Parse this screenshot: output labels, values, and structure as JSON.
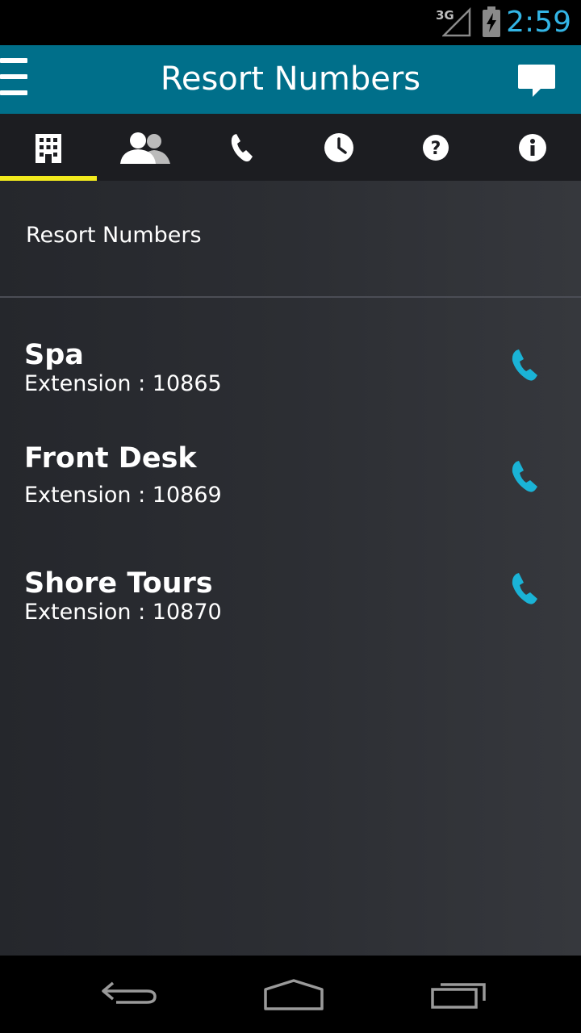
{
  "status_bar": {
    "network": "3G",
    "time": "2:59",
    "icons": [
      "signal-icon",
      "battery-charging-icon"
    ]
  },
  "action_bar": {
    "title": "Resort Numbers",
    "left_icon": "menu-icon",
    "right_icon": "chat-bubble-icon"
  },
  "tabs": [
    {
      "icon": "building-icon",
      "active": true
    },
    {
      "icon": "people-icon",
      "active": false
    },
    {
      "icon": "phone-icon",
      "active": false
    },
    {
      "icon": "clock-icon",
      "active": false
    },
    {
      "icon": "help-icon",
      "active": false
    },
    {
      "icon": "info-icon",
      "active": false
    }
  ],
  "colors": {
    "action_bar": "#006f8a",
    "tab_indicator": "#f2ea1d",
    "clock": "#33b5e5",
    "call_icon": "#1ab3d6"
  },
  "main": {
    "section_header": "Resort Numbers",
    "entries": [
      {
        "name": "Spa",
        "extension": "Extension : 10865",
        "icon": "call-icon"
      },
      {
        "name": "Front Desk",
        "extension": "Extension : 10869",
        "icon": "call-icon"
      },
      {
        "name": "Shore Tours",
        "extension": "Extension : 10870",
        "icon": "call-icon"
      }
    ]
  },
  "nav_bar": {
    "buttons": [
      "back-icon",
      "home-icon",
      "recent-apps-icon"
    ]
  }
}
